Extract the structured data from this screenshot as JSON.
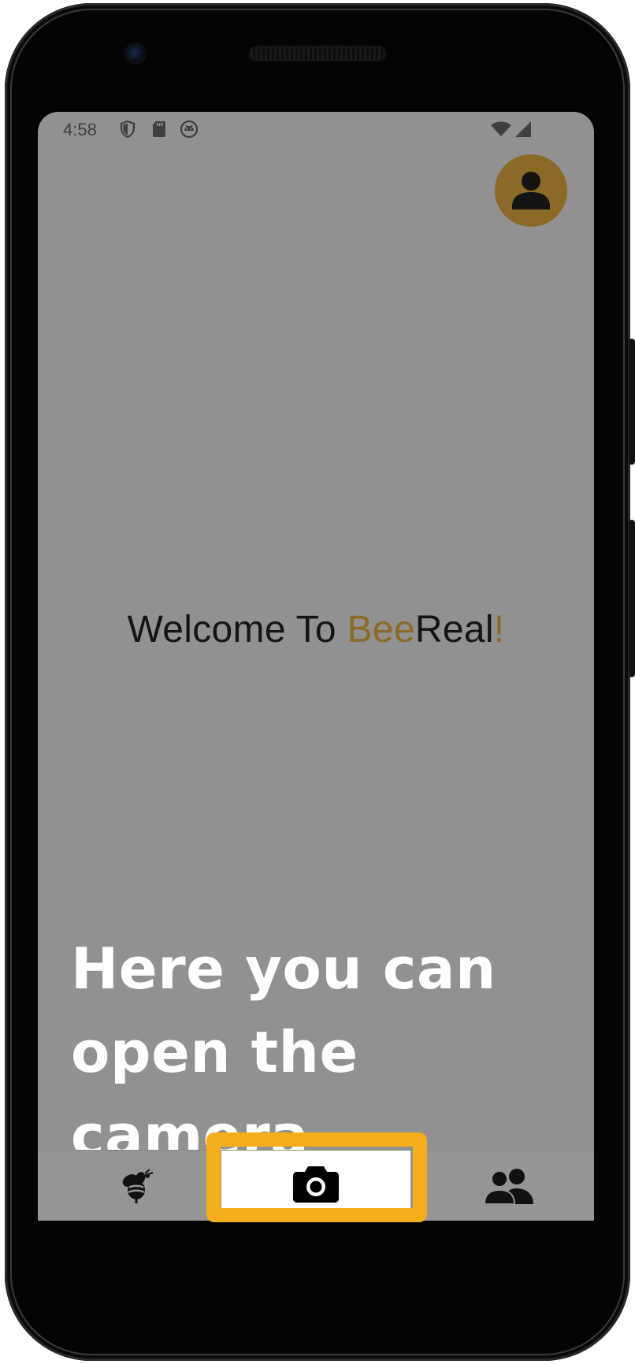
{
  "status_bar": {
    "time": "4:58"
  },
  "main": {
    "welcome_prefix": "Welcome To ",
    "welcome_brand_accent": "Bee",
    "welcome_brand_rest": "Real",
    "welcome_exclaim": "!"
  },
  "tutorial": {
    "line1": "Here you can",
    "line2": "open the camera"
  },
  "bottom_nav": {
    "items": [
      {
        "icon": "bee-icon"
      },
      {
        "icon": "camera-icon",
        "selected": true
      },
      {
        "icon": "friends-icon"
      }
    ]
  },
  "colors": {
    "accent": "#8a6a26",
    "highlight": "#f4ad1b",
    "overlay": "#919191"
  }
}
